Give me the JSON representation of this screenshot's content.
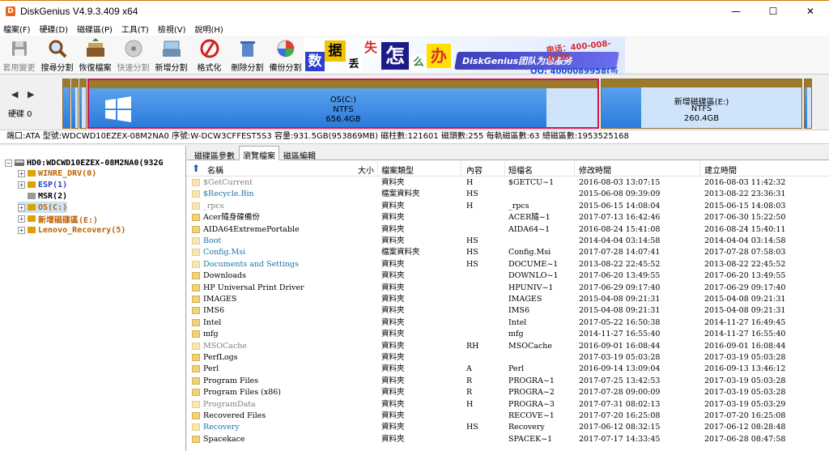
{
  "window": {
    "title": "DiskGenius V4.9.3.409 x64",
    "app_icon": "D",
    "min": "—",
    "max": "☐",
    "close": "✕"
  },
  "menu": [
    "檔案(F)",
    "硬碟(D)",
    "磁碟區(P)",
    "工具(T)",
    "檢視(V)",
    "說明(H)"
  ],
  "toolbar": [
    {
      "label": "套用變更",
      "icon": "save-icon",
      "enabled": false
    },
    {
      "label": "搜尋分割",
      "icon": "search-icon",
      "enabled": true
    },
    {
      "label": "恢復檔案",
      "icon": "recover-icon",
      "enabled": true
    },
    {
      "label": "快速分割",
      "icon": "quick-partition-icon",
      "enabled": false
    },
    {
      "label": "新增分割",
      "icon": "new-partition-icon",
      "enabled": true
    },
    {
      "label": "格式化",
      "icon": "format-icon",
      "enabled": true
    },
    {
      "label": "刪除分割",
      "icon": "delete-icon",
      "enabled": true
    },
    {
      "label": "備份分割",
      "icon": "backup-icon",
      "enabled": true
    }
  ],
  "banner": {
    "chars": [
      "数",
      "据",
      "丢",
      "失",
      "怎",
      "么",
      "办"
    ],
    "slogan": "DiskGenius团队为您服务",
    "phone_top": "电话：400-008-9958",
    "qq": "QQ: 4000089958(与电话同号)"
  },
  "disk": {
    "nav": "◀ ▶",
    "label": "硬碟 0",
    "partitions": [
      {
        "name": "OS(C:)",
        "fs": "NTFS",
        "size": "656.4GB",
        "used": 0.9
      },
      {
        "name": "新增磁碟區(E:)",
        "fs": "NTFS",
        "size": "260.4GB",
        "used": 0.2
      }
    ],
    "info": "端口:ATA  型號:WDCWD10EZEX-08M2NA0  序號:W-DCW3CFFEST5S3  容量:931.5GB(953869MB)  磁柱數:121601  磁頭數:255  每軌磁區數:63  總磁區數:1953525168"
  },
  "tree": {
    "root": "HD0:WDCWD10EZEX-08M2NA0(932G",
    "items": [
      {
        "label": "WINRE_DRV(0)",
        "color": "#c06000"
      },
      {
        "label": "ESP(1)",
        "color": "#3040c0"
      },
      {
        "label": "MSR(2)",
        "color": "#000000"
      },
      {
        "label": "OS(C:)",
        "color": "#c06000"
      },
      {
        "label": "新增磁碟區(E:)",
        "color": "#c06000"
      },
      {
        "label": "Lenovo_Recovery(5)",
        "color": "#c06000"
      }
    ]
  },
  "tabs": [
    "磁碟區參數",
    "瀏覽檔案",
    "磁區編輯"
  ],
  "columns": [
    "名稱",
    "大小",
    "檔案類型",
    "內容",
    "短檔名",
    "修改時間",
    "建立時間"
  ],
  "files": [
    {
      "name": "$GetCurrent",
      "type": "資料夾",
      "attr": "H",
      "short": "$GETCU~1",
      "mod": "2016-08-03 13:07:15",
      "created": "2016-08-03 11:42:32",
      "color": "#808080",
      "icon": "light"
    },
    {
      "name": "$Recycle.Bin",
      "type": "檔案資料夾",
      "attr": "HS",
      "short": "",
      "mod": "2015-06-08 09:39:09",
      "created": "2013-08-22 23:36:31",
      "color": "#1a73a8",
      "icon": "light"
    },
    {
      "name": "_rpcs",
      "type": "資料夾",
      "attr": "H",
      "short": "_rpcs",
      "mod": "2015-06-15 14:08:04",
      "created": "2015-06-15 14:08:03",
      "color": "#808080",
      "icon": "light"
    },
    {
      "name": "Acer隨身碟備份",
      "type": "資料夾",
      "attr": "",
      "short": "ACER隨~1",
      "mod": "2017-07-13 16:42:46",
      "created": "2017-06-30 15:22:50",
      "color": "#000000",
      "icon": "normal"
    },
    {
      "name": "AIDA64ExtremePortable",
      "type": "資料夾",
      "attr": "",
      "short": "AIDA64~1",
      "mod": "2016-08-24 15:41:08",
      "created": "2016-08-24 15:40:11",
      "color": "#000000",
      "icon": "normal"
    },
    {
      "name": "Boot",
      "type": "資料夾",
      "attr": "HS",
      "short": "",
      "mod": "2014-04-04 03:14:58",
      "created": "2014-04-04 03:14:58",
      "color": "#1a73a8",
      "icon": "light"
    },
    {
      "name": "Config.Msi",
      "type": "檔案資料夾",
      "attr": "HS",
      "short": "Config.Msi",
      "mod": "2017-07-28 14:07:41",
      "created": "2017-07-28 07:58:03",
      "color": "#1a73a8",
      "icon": "light"
    },
    {
      "name": "Documents and Settings",
      "type": "資料夾",
      "attr": "HS",
      "short": "DOCUME~1",
      "mod": "2013-08-22 22:45:52",
      "created": "2013-08-22 22:45:52",
      "color": "#1a73a8",
      "icon": "light"
    },
    {
      "name": "Downloads",
      "type": "資料夾",
      "attr": "",
      "short": "DOWNLO~1",
      "mod": "2017-06-20 13:49:55",
      "created": "2017-06-20 13:49:55",
      "color": "#000000",
      "icon": "normal"
    },
    {
      "name": "HP Universal Print Driver",
      "type": "資料夾",
      "attr": "",
      "short": "HPUNIV~1",
      "mod": "2017-06-29 09:17:40",
      "created": "2017-06-29 09:17:40",
      "color": "#000000",
      "icon": "normal"
    },
    {
      "name": "IMAGES",
      "type": "資料夾",
      "attr": "",
      "short": "IMAGES",
      "mod": "2015-04-08 09:21:31",
      "created": "2015-04-08 09:21:31",
      "color": "#000000",
      "icon": "normal"
    },
    {
      "name": "IMS6",
      "type": "資料夾",
      "attr": "",
      "short": "IMS6",
      "mod": "2015-04-08 09:21:31",
      "created": "2015-04-08 09:21:31",
      "color": "#000000",
      "icon": "normal"
    },
    {
      "name": "Intel",
      "type": "資料夾",
      "attr": "",
      "short": "Intel",
      "mod": "2017-05-22 16:50:38",
      "created": "2014-11-27 16:49:45",
      "color": "#000000",
      "icon": "normal"
    },
    {
      "name": "mfg",
      "type": "資料夾",
      "attr": "",
      "short": "mfg",
      "mod": "2014-11-27 16:55:40",
      "created": "2014-11-27 16:55:40",
      "color": "#000000",
      "icon": "normal"
    },
    {
      "name": "MSOCache",
      "type": "資料夾",
      "attr": "RH",
      "short": "MSOCache",
      "mod": "2016-09-01 16:08:44",
      "created": "2016-09-01 16:08:44",
      "color": "#808080",
      "icon": "light"
    },
    {
      "name": "PerfLogs",
      "type": "資料夾",
      "attr": "",
      "short": "",
      "mod": "2017-03-19 05:03:28",
      "created": "2017-03-19 05:03:28",
      "color": "#000000",
      "icon": "normal"
    },
    {
      "name": "Perl",
      "type": "資料夾",
      "attr": "A",
      "short": "Perl",
      "mod": "2016-09-14 13:09:04",
      "created": "2016-09-13 13:46:12",
      "color": "#000000",
      "icon": "normal"
    },
    {
      "name": "Program Files",
      "type": "資料夾",
      "attr": "R",
      "short": "PROGRA~1",
      "mod": "2017-07-25 13:42:53",
      "created": "2017-03-19 05:03:28",
      "color": "#000000",
      "icon": "normal"
    },
    {
      "name": "Program Files (x86)",
      "type": "資料夾",
      "attr": "R",
      "short": "PROGRA~2",
      "mod": "2017-07-28 09:00:09",
      "created": "2017-03-19 05:03:28",
      "color": "#000000",
      "icon": "normal"
    },
    {
      "name": "ProgramData",
      "type": "資料夾",
      "attr": "H",
      "short": "PROGRA~3",
      "mod": "2017-07-31 08:02:13",
      "created": "2017-03-19 05:03:29",
      "color": "#808080",
      "icon": "light"
    },
    {
      "name": "Recovered Files",
      "type": "資料夾",
      "attr": "",
      "short": "RECOVE~1",
      "mod": "2017-07-20 16:25:08",
      "created": "2017-07-20 16:25:08",
      "color": "#000000",
      "icon": "normal"
    },
    {
      "name": "Recovery",
      "type": "資料夾",
      "attr": "HS",
      "short": "Recovery",
      "mod": "2017-06-12 08:32:15",
      "created": "2017-06-12 08:28:48",
      "color": "#1a73a8",
      "icon": "light"
    },
    {
      "name": "Spacekace",
      "type": "資料夾",
      "attr": "",
      "short": "SPACEK~1",
      "mod": "2017-07-17 14:33:45",
      "created": "2017-06-28 08:47:58",
      "color": "#000000",
      "icon": "normal"
    }
  ]
}
